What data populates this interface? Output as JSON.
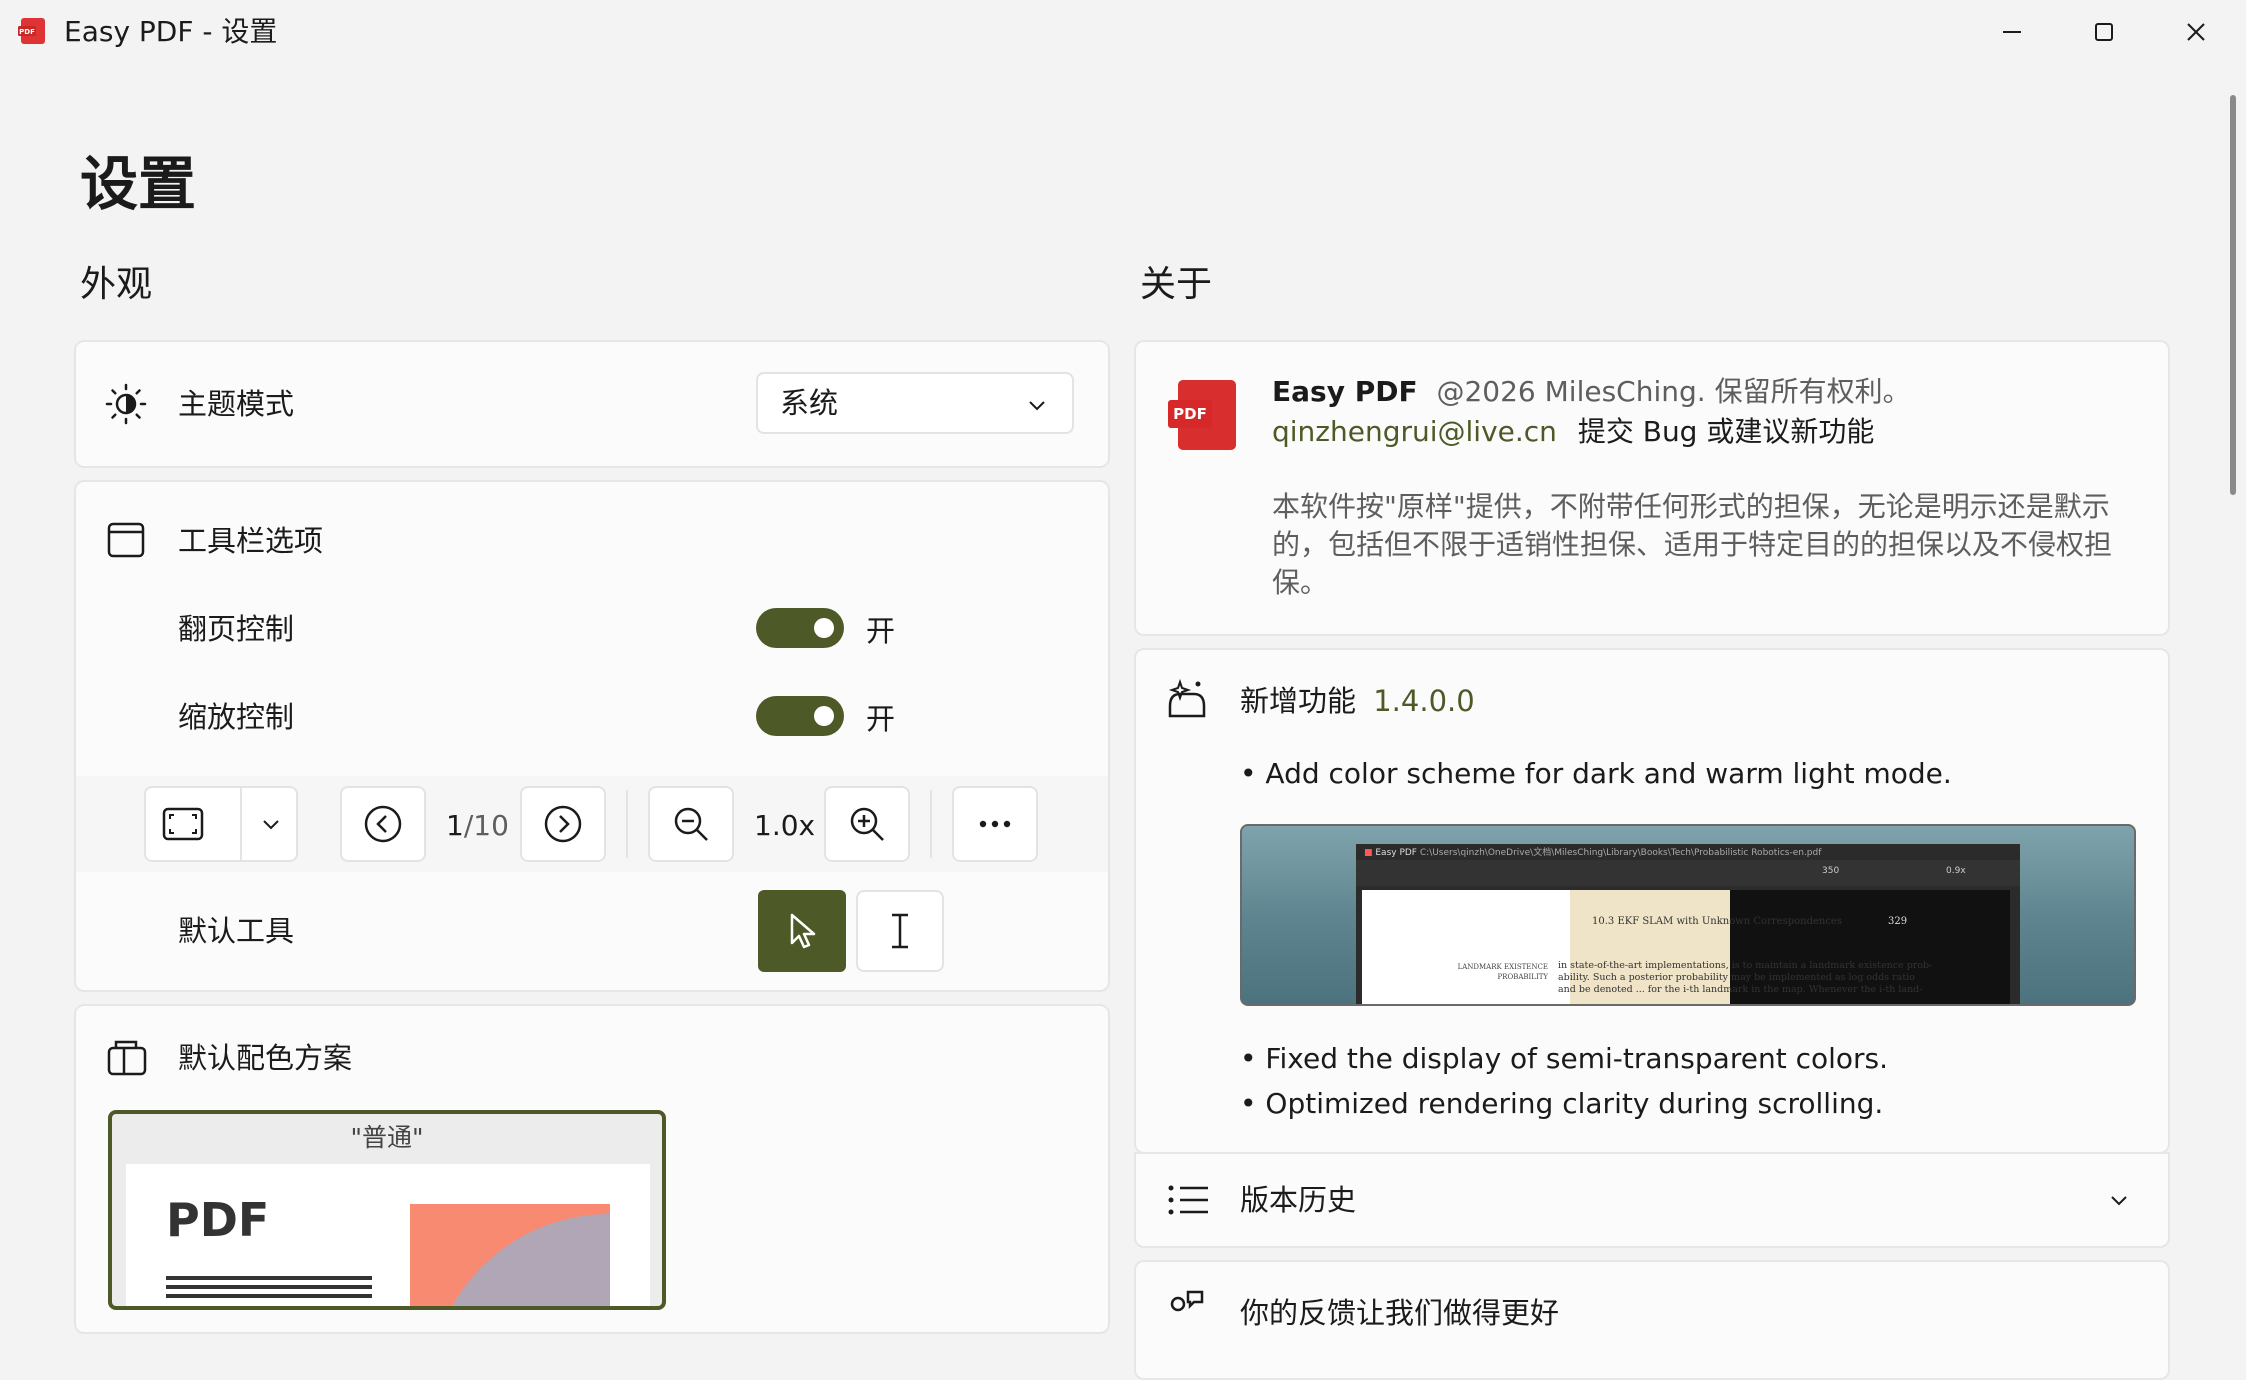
{
  "window": {
    "title": "Easy PDF - 设置",
    "app_icon_text": "PDF"
  },
  "page": {
    "title": "设置"
  },
  "appearance": {
    "section_title": "外观",
    "theme": {
      "label": "主题模式",
      "value": "系统"
    },
    "toolbar": {
      "label": "工具栏选项",
      "page_control": {
        "label": "翻页控制",
        "state": "开"
      },
      "zoom_control": {
        "label": "缩放控制",
        "state": "开"
      },
      "preview": {
        "page_current": "1",
        "page_total": "/10",
        "zoom": "1.0x"
      },
      "default_tool": {
        "label": "默认工具"
      }
    },
    "color_scheme": {
      "label": "默认配色方案",
      "option_name": "\"普通\"",
      "preview_text": "PDF"
    }
  },
  "about": {
    "section_title": "关于",
    "app_name": "Easy PDF",
    "copyright": "@2026 MilesChing. 保留所有权利。",
    "email": "qinzhengrui@live.cn",
    "feedback_link": "提交 Bug 或建议新功能",
    "disclaimer": "本软件按\"原样\"提供，不附带任何形式的担保，无论是明示还是默示的，包括但不限于适销性担保、适用于特定目的的担保以及不侵权担保。",
    "whats_new": {
      "label": "新增功能",
      "version": "1.4.0.0",
      "items": [
        "• Add color scheme for dark and warm light mode.",
        "• Fixed the display of semi-transparent colors.",
        "• Optimized rendering clarity during scrolling."
      ],
      "screenshot": {
        "title": "Easy PDF",
        "path": "C:\\Users\\qinzh\\OneDrive\\文档\\MilesChing\\Library\\Books\\Tech\\Probabilistic Robotics-en.pdf",
        "heading": "10.3  EKF SLAM with Unknown Correspondences",
        "page_number": "329",
        "margin_note": "LANDMARK EXISTENCE PROBABILITY",
        "line1": "in state-of-the-art implementations, is to maintain a landmark existence prob-",
        "line2": "ability. Such a posterior probability may be implemented as log odds ratio",
        "line3": "and be denoted ... for the i-th landmark in the map. Whenever the i-th land-",
        "zoom": "0.9x",
        "page": "350"
      }
    },
    "version_history": {
      "label": "版本历史"
    },
    "feedback": {
      "label": "你的反馈让我们做得更好"
    }
  },
  "colors": {
    "accent": "#4d5a27",
    "pdf_red": "#e03333",
    "background": "#f3f3f3",
    "card": "#fbfbfb"
  }
}
